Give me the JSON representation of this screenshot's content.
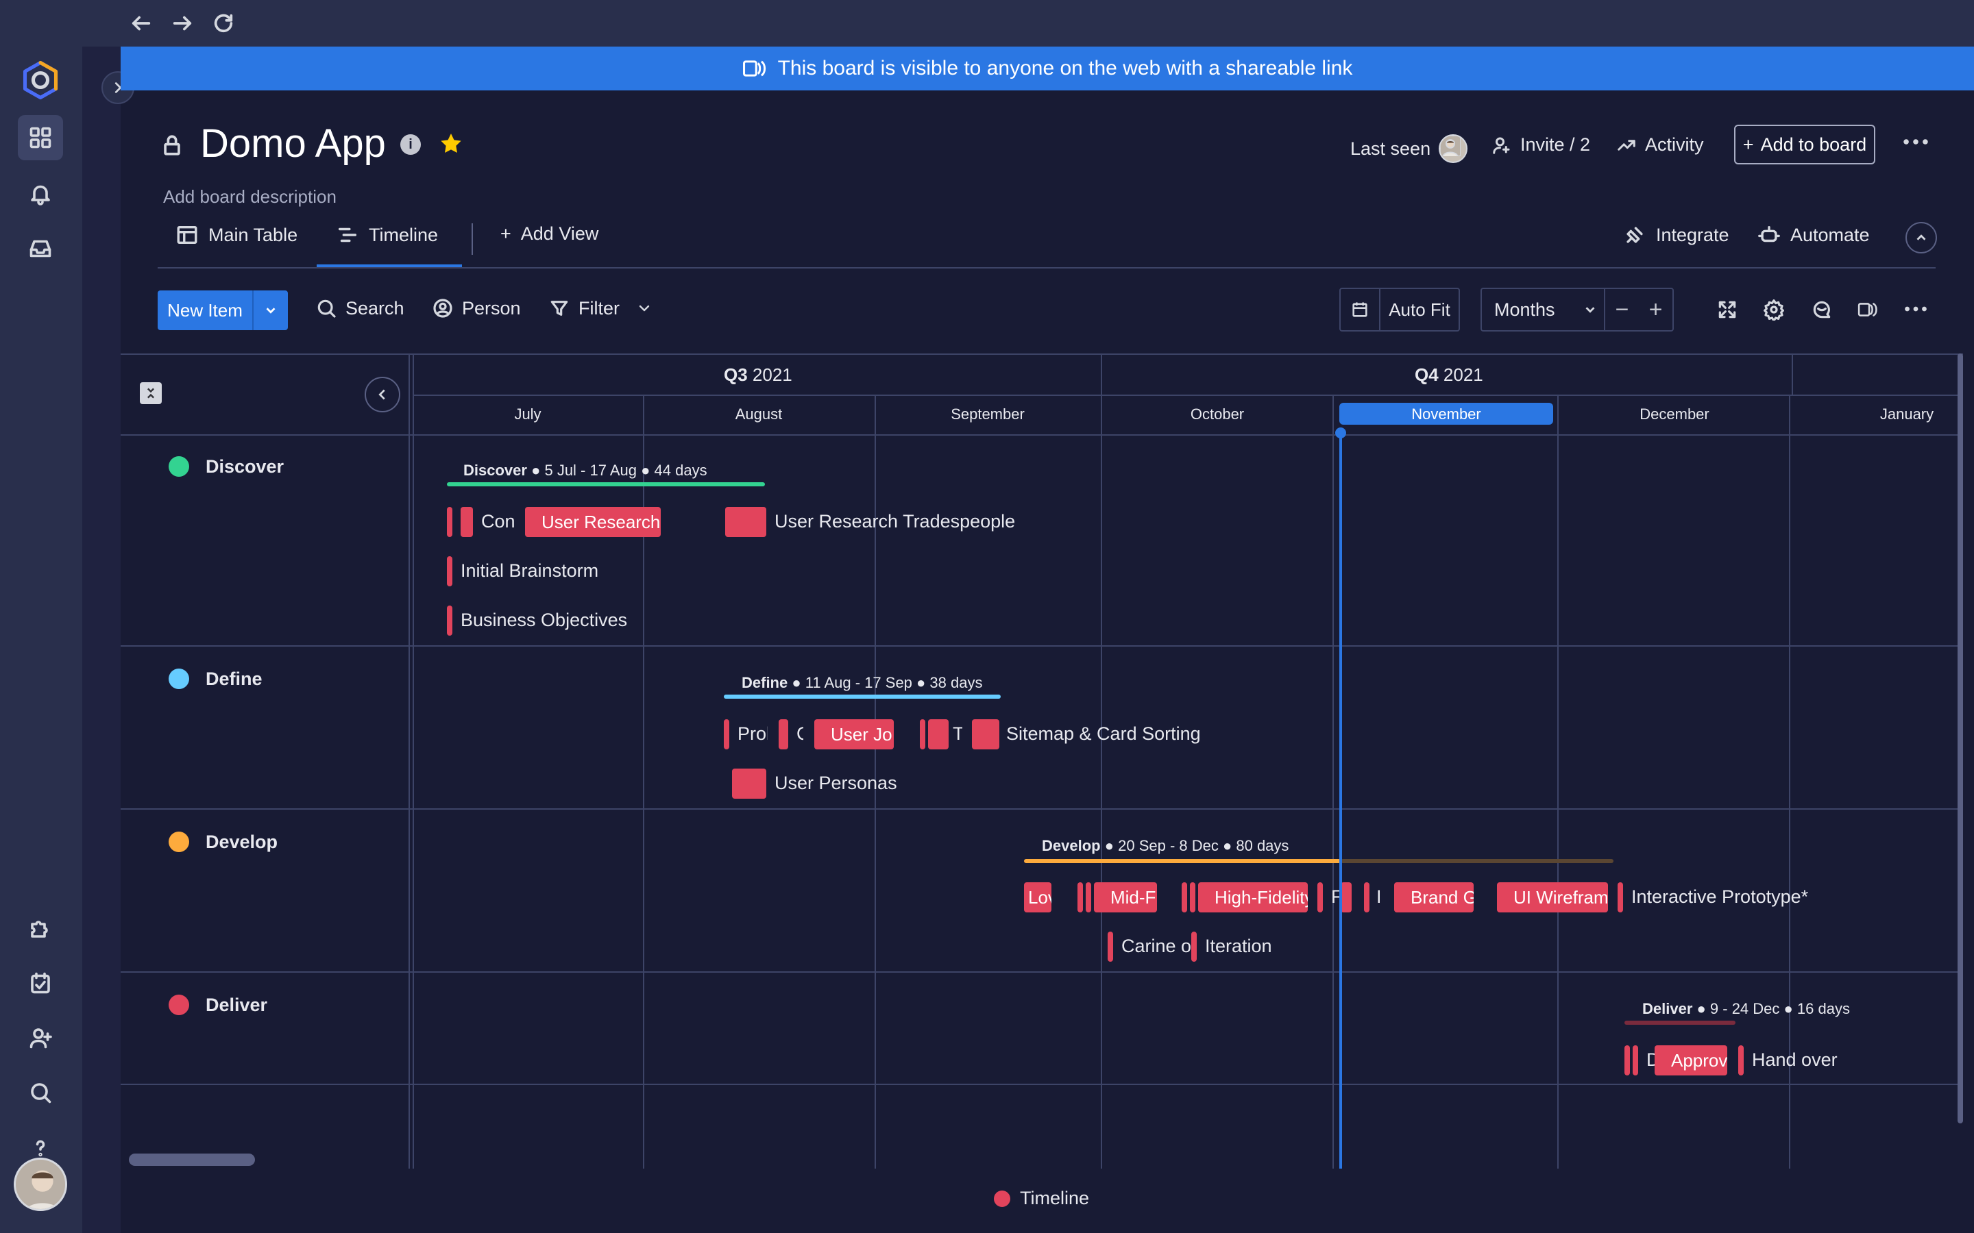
{
  "banner": {
    "text": "This board is visible to anyone on the web with a shareable link"
  },
  "board": {
    "title": "Domo App",
    "description": "Add board description"
  },
  "header": {
    "last_seen": "Last seen",
    "invite": "Invite / 2",
    "activity": "Activity",
    "add_to_board": "Add to board"
  },
  "tabs": {
    "main_table": "Main Table",
    "timeline": "Timeline",
    "add_view": "Add View",
    "integrate": "Integrate",
    "automate": "Automate"
  },
  "toolbar": {
    "new_item": "New Item",
    "search": "Search",
    "person": "Person",
    "filter": "Filter",
    "auto_fit": "Auto Fit",
    "zoom": "Months",
    "minus": "−",
    "plus": "+"
  },
  "timeline": {
    "quarters": [
      {
        "bold": "Q3",
        "rest": " 2021"
      },
      {
        "bold": "Q4",
        "rest": " 2021"
      }
    ],
    "months": [
      "July",
      "August",
      "September",
      "October",
      "November",
      "December",
      "January"
    ],
    "current_month": "November",
    "groups": [
      {
        "name": "Discover",
        "color": "#33d391",
        "summary_name": "Discover",
        "summary_rest": " ● 5 Jul - 17 Aug ● 44 days",
        "items": [
          "Con",
          "User Research Homeo",
          "User Research Tradespeople",
          "Initial Brainstorm",
          "Business Objectives"
        ]
      },
      {
        "name": "Define",
        "color": "#66ccff",
        "summary_name": "Define",
        "summary_rest": " ● 11 Aug - 17 Sep ● 38 days",
        "items": [
          "Prol",
          "C",
          "User Jo",
          "T",
          "Sitemap & Card Sorting",
          "User Personas"
        ]
      },
      {
        "name": "Develop",
        "color": "#fdab3d",
        "summary_name": "Develop",
        "summary_rest": " ● 20 Sep - 8 Dec ● 80 days",
        "items": [
          "Lov",
          "Mid-Fi",
          "High-Fidelity",
          "F",
          "I",
          "Brand G",
          "UI Wirefram",
          "Interactive Prototype*",
          "Carine o",
          "Iteration"
        ]
      },
      {
        "name": "Deliver",
        "color": "#e2445c",
        "summary_name": "Deliver",
        "summary_rest": " ● 9 - 24 Dec ● 16 days",
        "items": [
          "D",
          "Approv",
          "Hand over"
        ]
      }
    ],
    "legend": "Timeline"
  }
}
